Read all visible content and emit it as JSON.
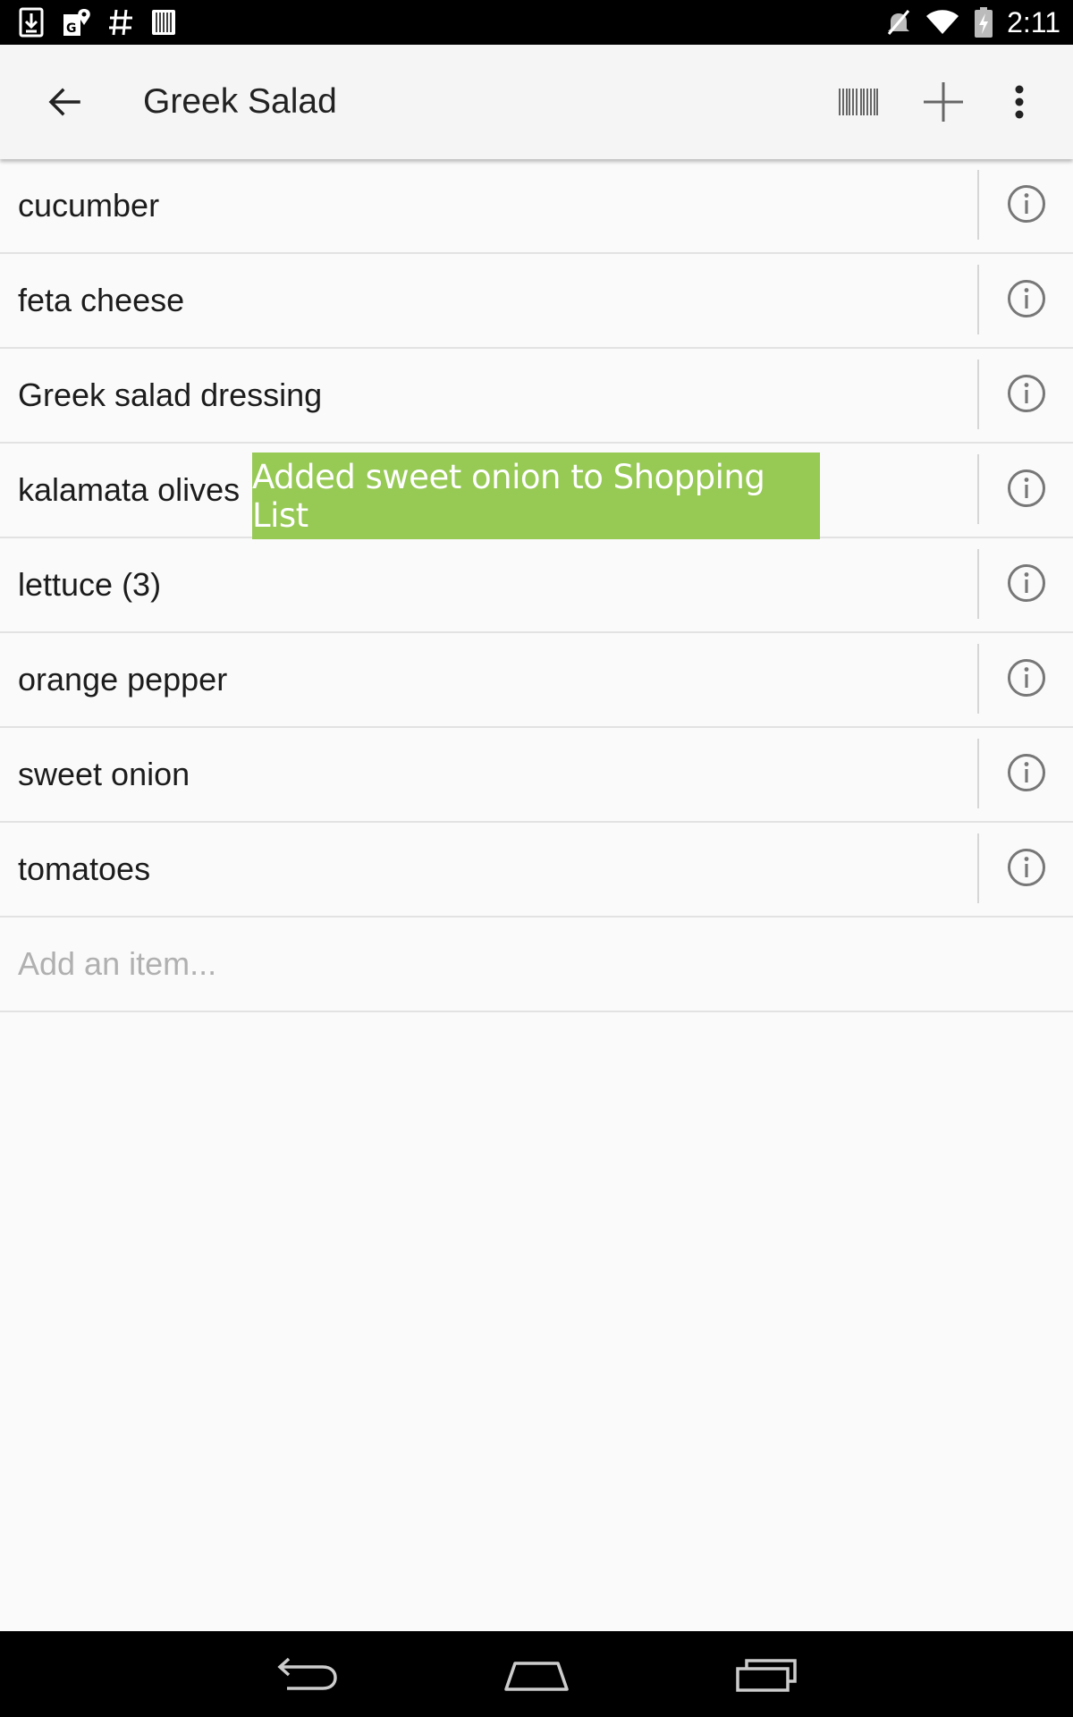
{
  "status_bar": {
    "time": "2:11",
    "left_icons": [
      "download-icon",
      "maps-icon",
      "hashtag-icon",
      "barcode-notification-icon"
    ],
    "right_icons": [
      "mute-icon",
      "wifi-icon",
      "battery-charging-icon"
    ]
  },
  "app_bar": {
    "title": "Greek Salad",
    "back_icon": "arrow-left-icon",
    "actions": [
      "barcode-icon",
      "plus-icon",
      "more-vert-icon"
    ]
  },
  "list": {
    "items": [
      {
        "label": "cucumber"
      },
      {
        "label": "feta cheese"
      },
      {
        "label": "Greek salad dressing"
      },
      {
        "label": "kalamata olives"
      },
      {
        "label": "lettuce (3)"
      },
      {
        "label": "orange pepper"
      },
      {
        "label": "sweet onion"
      },
      {
        "label": "tomatoes"
      }
    ],
    "add_placeholder": "Add an item..."
  },
  "toast": {
    "message": "Added sweet onion to Shopping List",
    "color": "#97c955"
  },
  "colors": {
    "status_bar": "#000000",
    "app_bar": "#f5f5f5",
    "background": "#fafafa",
    "toast": "#97c955"
  }
}
